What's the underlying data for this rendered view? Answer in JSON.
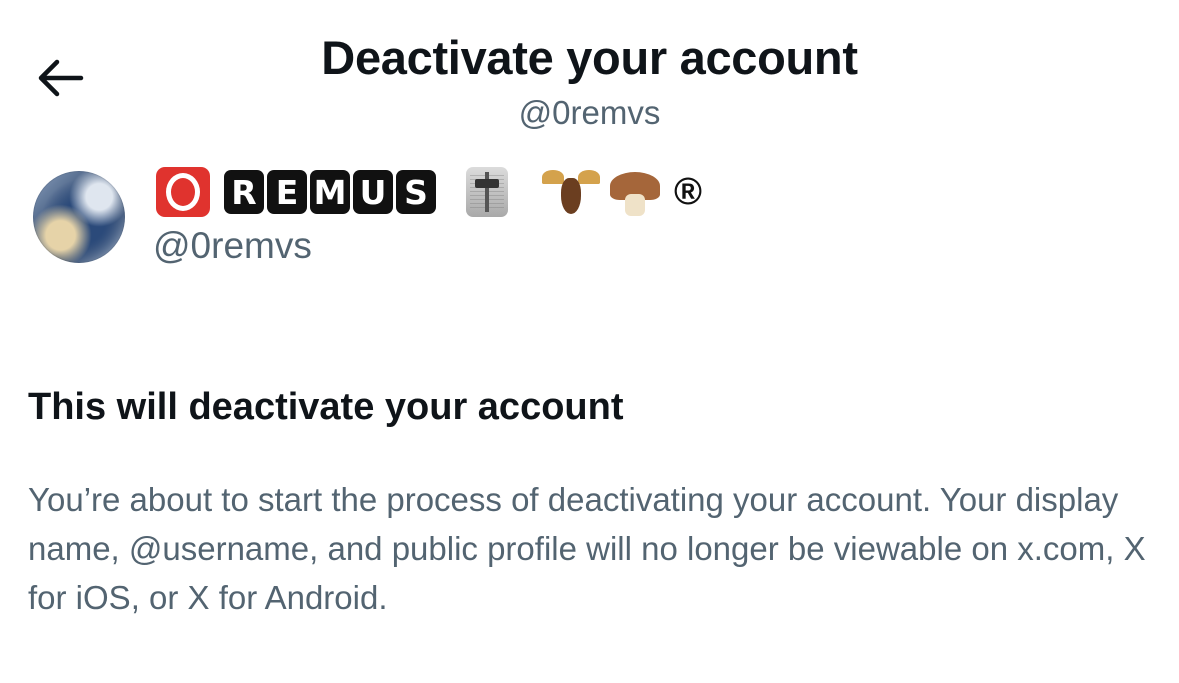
{
  "header": {
    "title": "Deactivate your account",
    "subtitle": "@0remvs",
    "back_icon": "arrow-left-icon"
  },
  "profile": {
    "display_name": {
      "prefix_emoji": "o-button-emoji",
      "letters": [
        "R",
        "E",
        "M",
        "U",
        "S"
      ],
      "emojis": [
        "level-slider-emoji",
        "moose-emoji",
        "mushroom-emoji"
      ],
      "suffix": "®"
    },
    "handle": "@0remvs"
  },
  "content": {
    "heading": "This will deactivate your account",
    "body": "You’re about to start the process of deactivating your account. Your display name, @username, and public profile will no longer be viewable on x.com, X for iOS, or X for Android."
  }
}
